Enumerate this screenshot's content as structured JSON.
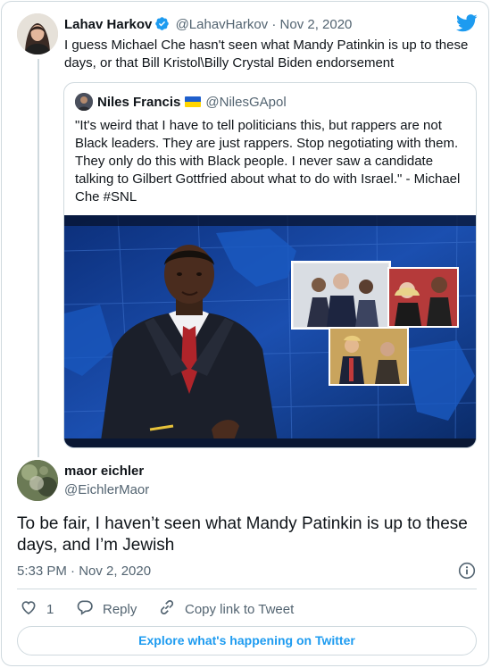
{
  "original_tweet": {
    "author_name": "Lahav Harkov",
    "author_handle": "@LahavHarkov",
    "separator": "·",
    "date": "Nov 2, 2020",
    "text": "I guess Michael Che hasn't seen what Mandy Patinkin is up to these days, or that Bill Kristol\\Billy Crystal Biden endorsement",
    "icons": [
      "verified-badge-icon",
      "twitter-logo-icon"
    ]
  },
  "quoted_tweet": {
    "author_name": "Niles Francis",
    "author_handle": "@NilesGApol",
    "flag": "ukraine-flag",
    "text": "\"It's weird that I have to tell politicians this, but rappers are not Black leaders. They are just rappers. Stop negotiating with them. They only do this with Black people. I never saw a candidate talking to Gilbert Gottfried about what to do with Israel.\" - Michael Che #SNL",
    "media": "photo of TV news desk anchor"
  },
  "reply_tweet": {
    "author_name": "maor eichler",
    "author_handle": "@EichlerMaor",
    "text": "To be fair, I haven’t seen what Mandy Patinkin is up to these days, and I’m Jewish",
    "timestamp": "5:33 PM · Nov 2, 2020"
  },
  "actions": {
    "like_count": "1",
    "reply_label": "Reply",
    "copy_label": "Copy link to Tweet"
  },
  "footer": {
    "explore_label": "Explore what's happening on Twitter"
  },
  "colors": {
    "accent": "#1d9bf0",
    "text": "#0f1419",
    "muted": "#536471",
    "border": "#cfd9de"
  }
}
